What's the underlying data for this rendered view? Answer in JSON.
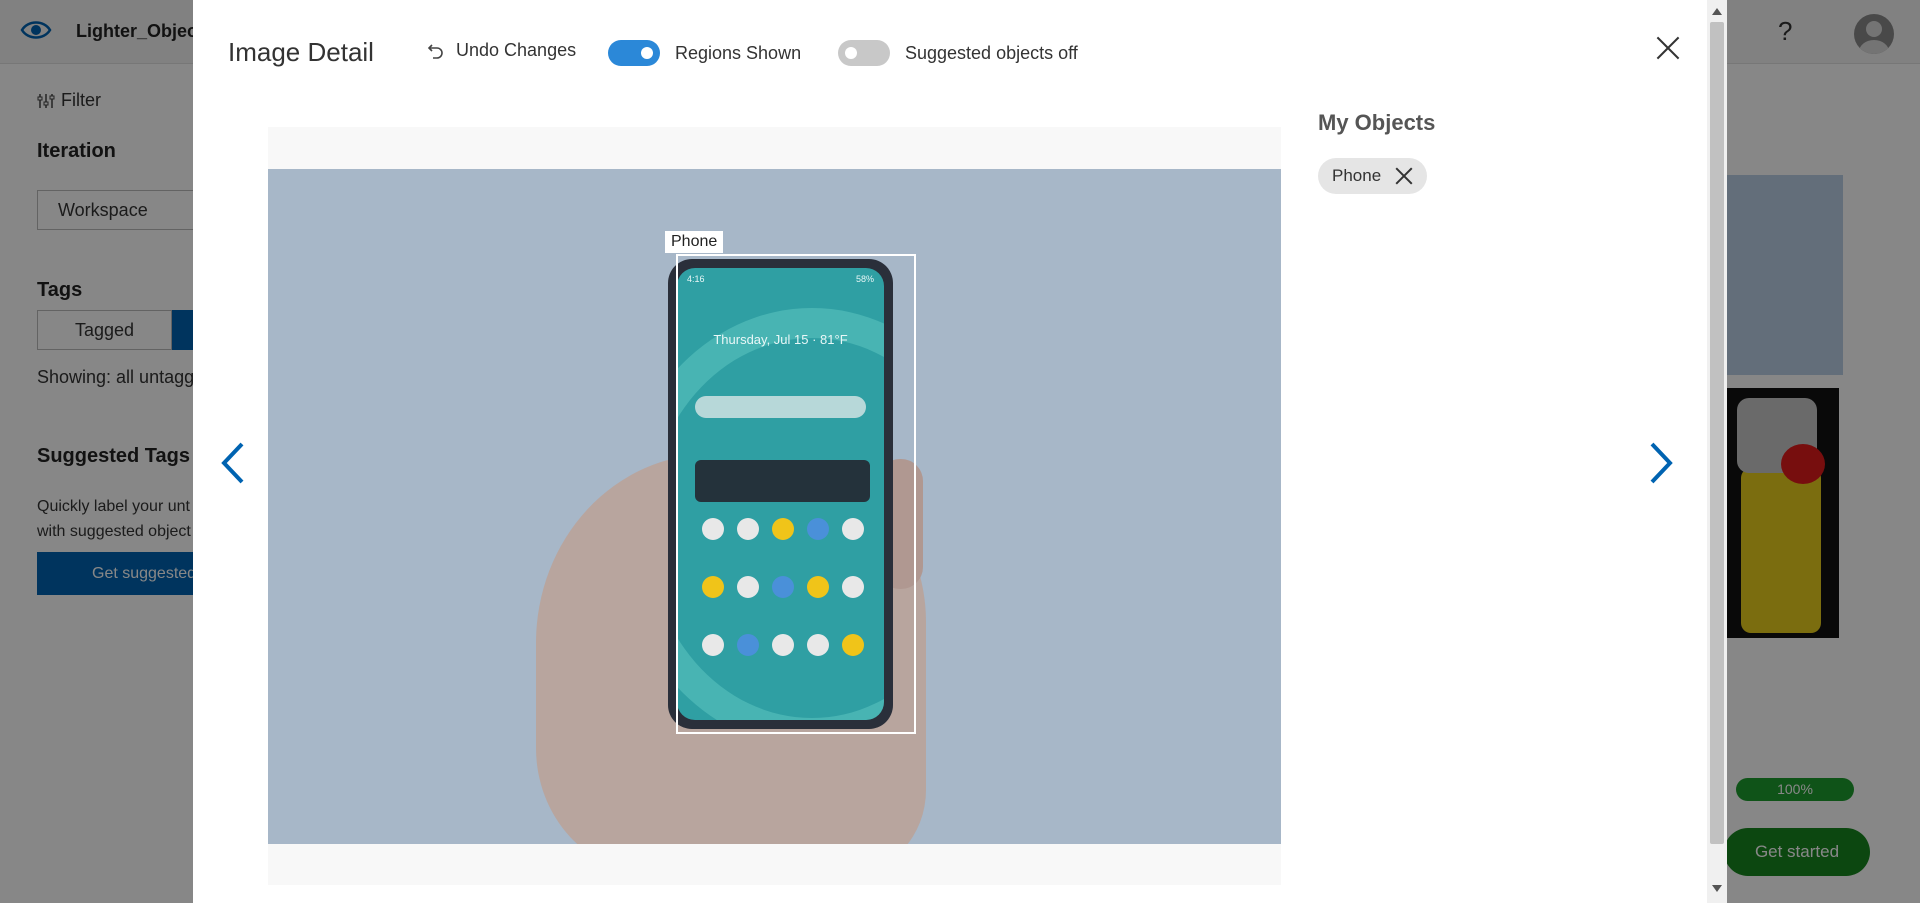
{
  "app": {
    "project_name": "Lighter_Object",
    "filter_label": "Filter",
    "iteration_heading": "Iteration",
    "iteration_value": "Workspace",
    "tags_heading": "Tags",
    "tagged_label": "Tagged",
    "showing_text": "Showing: all untagg",
    "suggested_tags_heading": "Suggested Tags",
    "suggested_tags_desc": "Quickly label your unt with suggested object",
    "suggested_button": "Get suggested",
    "help_label": "?",
    "progress_text": "100%",
    "get_started_label": "Get started"
  },
  "modal": {
    "title": "Image Detail",
    "undo_label": "Undo Changes",
    "regions_label": "Regions Shown",
    "regions_on": true,
    "suggested_label": "Suggested objects off",
    "suggested_on": false
  },
  "image": {
    "region_label": "Phone",
    "status_left": "4:16",
    "status_right": "58%",
    "date_text": "Thursday, Jul 15 · 81°F"
  },
  "side": {
    "title": "My Objects",
    "objects": [
      "Phone"
    ]
  },
  "colors": {
    "accent": "#0063b1",
    "toggle_on": "#2b88d8",
    "success": "#17871f"
  }
}
